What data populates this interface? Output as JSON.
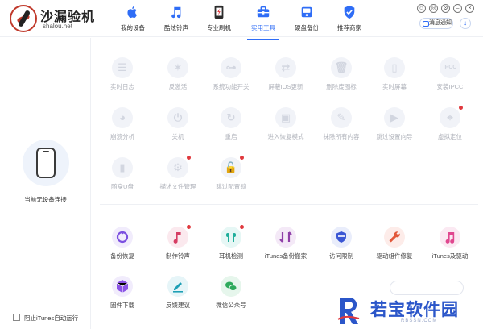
{
  "brand": {
    "name": "沙漏验机",
    "domain": "shalou.net"
  },
  "nav": [
    {
      "label": "我的设备",
      "icon": "apple-icon"
    },
    {
      "label": "酷炫铃声",
      "icon": "music-note-icon"
    },
    {
      "label": "专业刷机",
      "icon": "phone-flash-icon"
    },
    {
      "label": "实用工具",
      "icon": "toolbox-icon",
      "active": true
    },
    {
      "label": "硬盘备份",
      "icon": "disk-backup-icon"
    },
    {
      "label": "推荐商家",
      "icon": "shield-check-icon"
    }
  ],
  "header": {
    "message_label": "消息通知",
    "download_icon": "download-icon"
  },
  "left": {
    "no_device": "当前无设备连接",
    "itunes_auto": "阻止iTunes自动运行"
  },
  "tools_top": [
    {
      "label": "实时日志",
      "icon": "log-icon"
    },
    {
      "label": "反激活",
      "icon": "deactivate-icon"
    },
    {
      "label": "系统功能开关",
      "icon": "toggle-icon"
    },
    {
      "label": "屏蔽IOS更新",
      "icon": "block-update-icon"
    },
    {
      "label": "删除废图标",
      "icon": "trash-icon"
    },
    {
      "label": "实时屏幕",
      "icon": "screen-icon"
    },
    {
      "label": "安装IPCC",
      "icon": "ipcc-icon"
    },
    {
      "label": "崩溃分析",
      "icon": "pie-chart-icon"
    },
    {
      "label": "关机",
      "icon": "power-icon"
    },
    {
      "label": "重启",
      "icon": "restart-icon"
    },
    {
      "label": "进入恢复模式",
      "icon": "recovery-icon"
    },
    {
      "label": "抹除所有内容",
      "icon": "erase-icon"
    },
    {
      "label": "跳过设置向导",
      "icon": "skip-wizard-icon"
    },
    {
      "label": "虚拟定位",
      "icon": "location-icon"
    },
    {
      "label": "随身U盘",
      "icon": "usb-icon"
    },
    {
      "label": "描述文件管理",
      "icon": "gear-icon"
    },
    {
      "label": "跳过配置锁",
      "icon": "unlock-icon"
    }
  ],
  "tools_bottom": [
    {
      "label": "备份恢复",
      "icon": "backup-restore-icon"
    },
    {
      "label": "制作铃声",
      "icon": "ringtone-icon"
    },
    {
      "label": "耳机检测",
      "icon": "earphones-icon"
    },
    {
      "label": "iTunes备份搬家",
      "icon": "transfer-icon"
    },
    {
      "label": "访问限制",
      "icon": "restriction-shield-icon"
    },
    {
      "label": "驱动组件修复",
      "icon": "wrench-icon"
    },
    {
      "label": "iTunes及驱动",
      "icon": "itunes-icon"
    },
    {
      "label": "固件下载",
      "icon": "firmware-cube-icon"
    },
    {
      "label": "反馈建议",
      "icon": "feedback-pen-icon"
    },
    {
      "label": "微信公众号",
      "icon": "wechat-icon"
    }
  ],
  "watermark": {
    "text": "若宝软件园",
    "sub": "RBSSN.COM"
  },
  "colors": {
    "accent": "#2f6df6",
    "badge": "#e0393e"
  }
}
